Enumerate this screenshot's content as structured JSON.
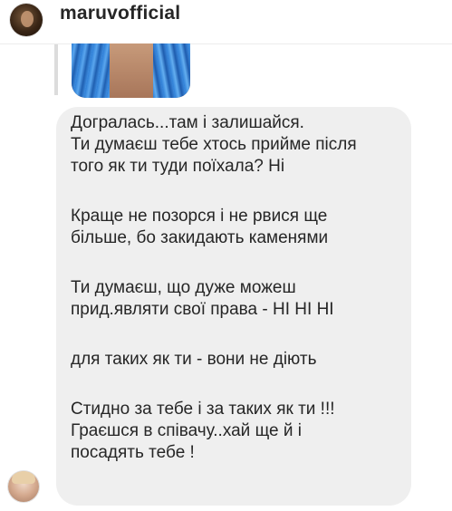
{
  "header": {
    "username": "maruvofficial"
  },
  "message": {
    "paragraphs": [
      [
        "Догралась...там і залишайся.",
        "Ти думаєш тебе хтось прийме після",
        "того як ти туди поїхала? Ні"
      ],
      [
        "Краще не позорся і не рвися ще",
        "більше, бо закидають каменями"
      ],
      [
        "Ти думаєш, що дуже можеш",
        "прид.являти свої права - НІ НІ НІ"
      ],
      [
        "для таких як ти - вони не діють"
      ],
      [
        "Стидно за тебе і за таких як ти !!!",
        "Граєшся в співачу..хай ще й і",
        "посадять тебе !"
      ]
    ]
  },
  "colors": {
    "bubble_background": "#efefef",
    "text": "#262626",
    "header_divider": "#ececec",
    "reply_line": "#dcdcdc"
  }
}
